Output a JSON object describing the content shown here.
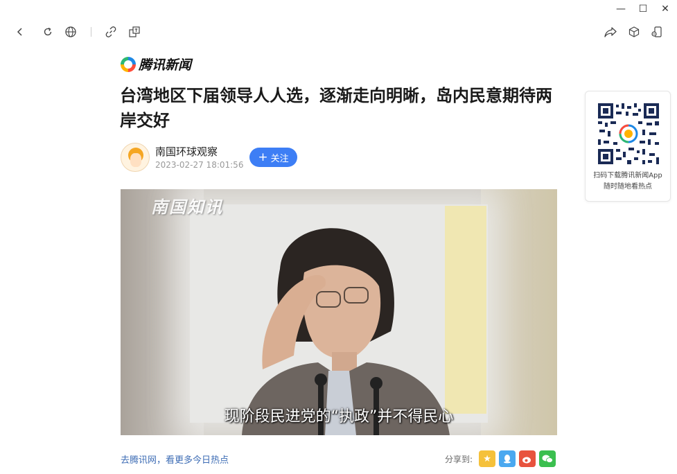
{
  "window": {
    "minimize_glyph": "—",
    "maximize_glyph": "☐",
    "close_glyph": "✕"
  },
  "toolbar": {
    "left_icons": [
      "back-icon",
      "refresh-icon",
      "globe-icon",
      "link-icon",
      "translate-icon"
    ],
    "right_icons": [
      "share-icon",
      "cube-icon",
      "phone-icon"
    ]
  },
  "article": {
    "brand": "腾讯新闻",
    "title": "台湾地区下届领导人人选，逐渐走向明晰，岛内民意期待两岸交好",
    "author_name": "南国环球观察",
    "publish_time": "2023-02-27 18:01:56",
    "follow_label": "关注",
    "image_watermark": "南国知讯",
    "image_caption": "现阶段民进党的“执政”并不得民心"
  },
  "footer": {
    "more_link": "去腾讯网，看更多今日热点",
    "share_label": "分享到:",
    "share_targets": [
      "qq-zone-icon",
      "qq-icon",
      "weibo-icon",
      "wechat-icon"
    ]
  },
  "qr_card": {
    "line1": "扫码下载腾讯新闻App",
    "line2": "随时随地看热点"
  },
  "colors": {
    "accent": "#3d7ef5",
    "link": "#3e6db5",
    "share_qzone": "#f5c13b",
    "share_qq": "#4aa8f0",
    "share_weibo": "#e8533e",
    "share_wechat": "#3bbf4f"
  }
}
